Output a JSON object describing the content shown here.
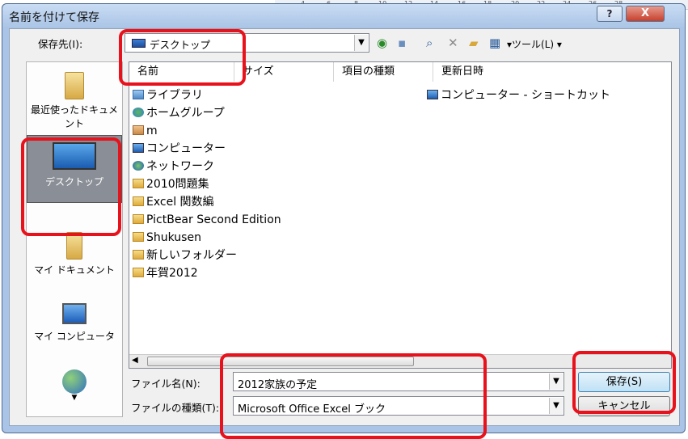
{
  "dialog": {
    "title": "名前を付けて保存",
    "help_label": "?",
    "close_label": "X"
  },
  "ruler_ticks": [
    "4",
    "6",
    "8",
    "10",
    "12",
    "14",
    "16",
    "18",
    "20",
    "22",
    "24",
    "26",
    "28"
  ],
  "toolbar": {
    "save_in_label": "保存先(I):",
    "save_in_value": "デスクトップ",
    "tools_label": "▾ツール(L) ▾"
  },
  "places": [
    {
      "label": "最近使ったドキュメント",
      "icon": "recent-folder-icon"
    },
    {
      "label": "デスクトップ",
      "icon": "desktop-monitor-icon",
      "selected": true
    },
    {
      "label": "マイ ドキュメント",
      "icon": "my-documents-icon"
    },
    {
      "label": "マイ コンピュータ",
      "icon": "my-computer-icon"
    },
    {
      "label": "",
      "icon": "network-globe-icon"
    }
  ],
  "columns": [
    "名前",
    "サイズ",
    "項目の種類",
    "更新日時"
  ],
  "files": [
    {
      "name": "ライブラリ",
      "icon": "lib"
    },
    {
      "name": "ホームグループ",
      "icon": "home"
    },
    {
      "name": "m",
      "icon": "user"
    },
    {
      "name": "コンピューター",
      "icon": "comp"
    },
    {
      "name": "ネットワーク",
      "icon": "net"
    },
    {
      "name": "2010問題集",
      "icon": "folder"
    },
    {
      "name": "Excel 関数編",
      "icon": "folder"
    },
    {
      "name": "PictBear Second Edition",
      "icon": "folder"
    },
    {
      "name": "Shukusen",
      "icon": "folder"
    },
    {
      "name": "新しいフォルダー",
      "icon": "folder"
    },
    {
      "name": "年賀2012",
      "icon": "folder"
    }
  ],
  "shortcut_item": "コンピューター - ショートカット",
  "form": {
    "filename_label": "ファイル名(N):",
    "filename_value": "2012家族の予定",
    "filetype_label": "ファイルの種類(T):",
    "filetype_value": "Microsoft Office Excel ブック",
    "save_button": "保存(S)",
    "cancel_button": "キャンセル"
  },
  "colors": {
    "annotation_red": "#e8121c",
    "window_frame": "#a9c4e6",
    "selected_place": "#8a8e96"
  }
}
